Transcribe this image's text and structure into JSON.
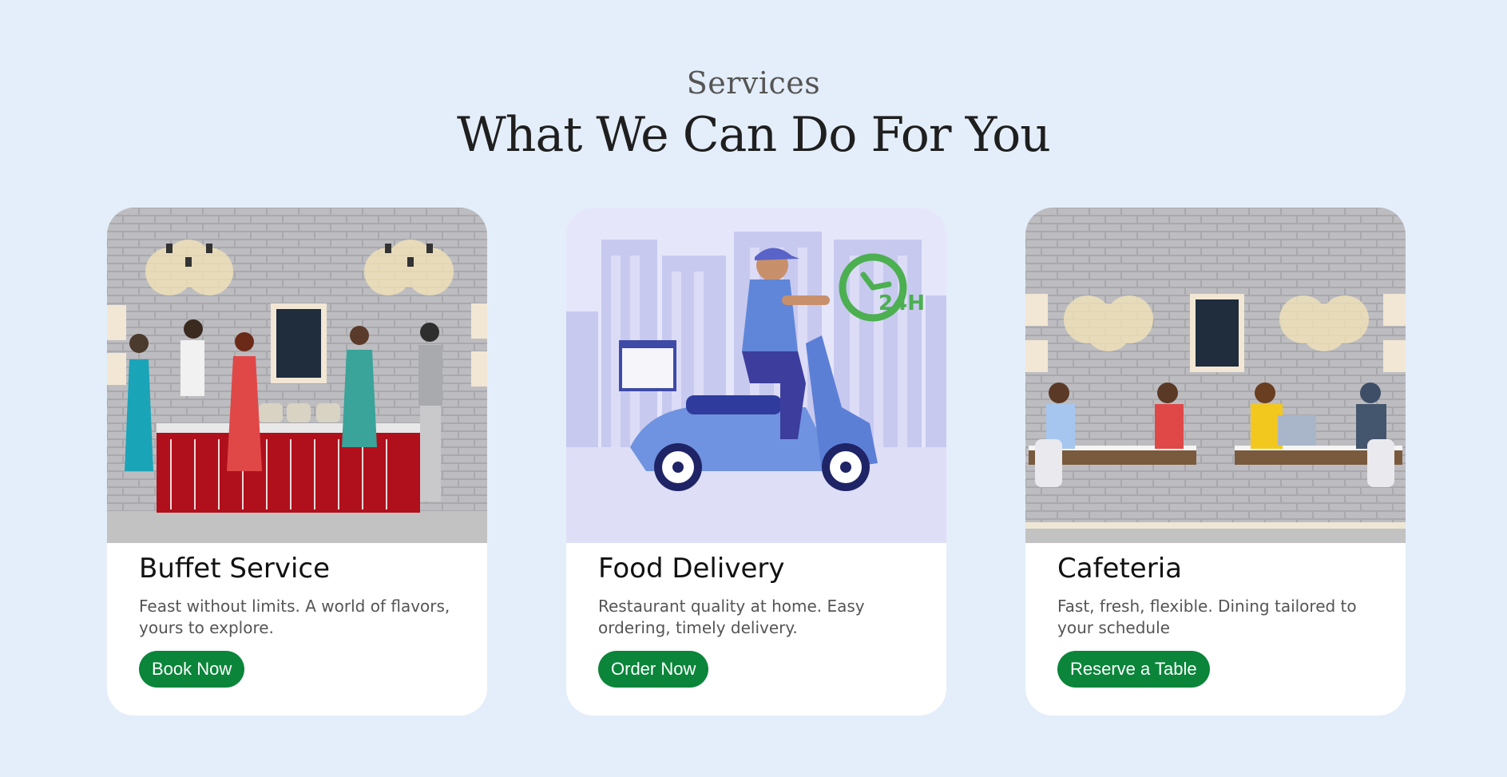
{
  "header": {
    "subtitle": "Services",
    "title": "What We Can Do For You"
  },
  "colors": {
    "background": "#e4eefa",
    "button": "#0a853a",
    "card": "#ffffff"
  },
  "cards": [
    {
      "title": "Buffet Service",
      "description": "Feast without limits. A world of flavors, yours to explore.",
      "button_label": "Book Now",
      "image": "buffet-illustration"
    },
    {
      "title": "Food Delivery",
      "description": "Restaurant quality at home. Easy ordering, timely delivery.",
      "button_label": "Order Now",
      "image": "scooter-delivery-illustration"
    },
    {
      "title": "Cafeteria",
      "description": "Fast, fresh, flexible. Dining tailored to your schedule",
      "button_label": "Reserve a Table",
      "image": "cafeteria-illustration"
    }
  ],
  "delivery_badge": "24H"
}
